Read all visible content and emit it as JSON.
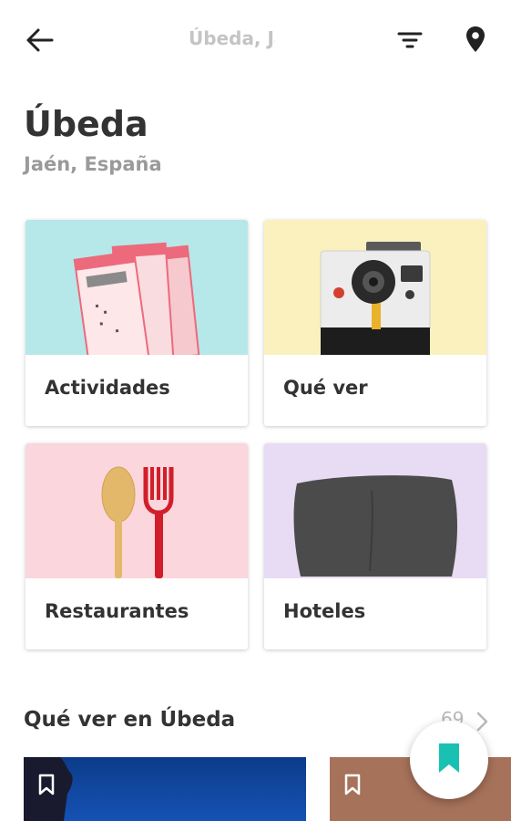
{
  "header": {
    "title": "Úbeda, Jaén"
  },
  "place": {
    "name": "Úbeda",
    "region": "Jaén, España"
  },
  "categories": [
    {
      "label": "Actividades",
      "image": "tickets-illustration",
      "bg": "#b6e8ea"
    },
    {
      "label": "Qué ver",
      "image": "camera-illustration",
      "bg": "#fbf1bf"
    },
    {
      "label": "Restaurantes",
      "image": "spoon-fork-illustration",
      "bg": "#fbd6dc"
    },
    {
      "label": "Hoteles",
      "image": "pillow-illustration",
      "bg": "#e7dcf3"
    }
  ],
  "section": {
    "title": "Qué ver en Úbeda",
    "count": "69"
  },
  "colors": {
    "accent": "#19c1b3",
    "title": "#333333",
    "subtitle": "#9a9a9a"
  }
}
